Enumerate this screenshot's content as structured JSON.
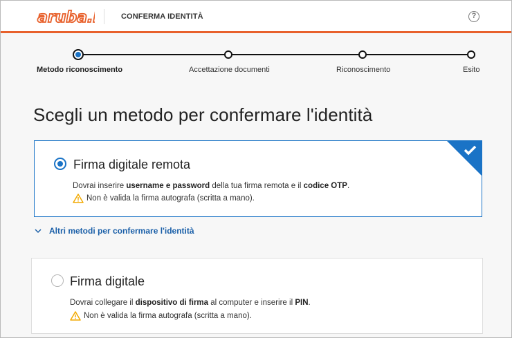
{
  "header": {
    "logo_text": "aruba.it",
    "title": "CONFERMA IDENTITÀ",
    "help_symbol": "?"
  },
  "stepper": {
    "steps": [
      {
        "label": "Metodo riconoscimento",
        "active": true
      },
      {
        "label": "Accettazione documenti",
        "active": false
      },
      {
        "label": "Riconoscimento",
        "active": false
      },
      {
        "label": "Esito",
        "active": false
      }
    ]
  },
  "page_title": "Scegli un metodo per confermare l'identità",
  "methods": [
    {
      "title": "Firma digitale remota",
      "selected": true,
      "desc_parts": [
        "Dovrai inserire ",
        "username e password",
        " della tua firma remota e il ",
        "codice OTP",
        "."
      ],
      "warning": "Non è valida la firma autografa (scritta a mano)."
    },
    {
      "title": "Firma digitale",
      "selected": false,
      "desc_parts": [
        "Dovrai collegare il ",
        "dispositivo di firma",
        " al computer e inserire il ",
        "PIN",
        "."
      ],
      "warning": "Non è valida la firma autografa (scritta a mano)."
    }
  ],
  "more_methods_label": "Altri metodi per confermare l'identità",
  "colors": {
    "brand_orange": "#e8612c",
    "accent_blue": "#1a73c6",
    "warning_yellow": "#f2a900"
  },
  "icons": {
    "help": "question-circle-icon",
    "check": "checkmark-icon",
    "warning": "warning-triangle-icon",
    "expand": "chevron-down-icon"
  }
}
